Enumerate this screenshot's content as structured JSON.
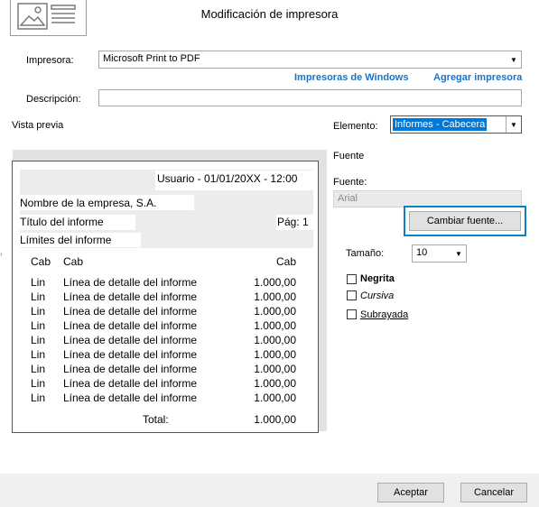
{
  "dialog": {
    "title": "Modificación de impresora"
  },
  "printer": {
    "label": "Impresora:",
    "value": "Microsoft Print to PDF",
    "windows_link": "Impresoras de Windows",
    "add_link": "Agregar impresora"
  },
  "description": {
    "label": "Descripción:",
    "value": ""
  },
  "preview": {
    "label": "Vista previa",
    "user_line": "Usuario - 01/01/20XX - 12:00",
    "company": "Nombre de la empresa, S.A.",
    "report_title": "Título del informe",
    "page": "Pág: 1",
    "limits": "Límites del informe",
    "columns": [
      "Cab",
      "Cab",
      "Cab"
    ],
    "rows": [
      {
        "c1": "Lin",
        "c2": "Línea de detalle del informe",
        "c3": "1.000,00"
      },
      {
        "c1": "Lin",
        "c2": "Línea de detalle del informe",
        "c3": "1.000,00"
      },
      {
        "c1": "Lin",
        "c2": "Línea de detalle del informe",
        "c3": "1.000,00"
      },
      {
        "c1": "Lin",
        "c2": "Línea de detalle del informe",
        "c3": "1.000,00"
      },
      {
        "c1": "Lin",
        "c2": "Línea de detalle del informe",
        "c3": "1.000,00"
      },
      {
        "c1": "Lin",
        "c2": "Línea de detalle del informe",
        "c3": "1.000,00"
      },
      {
        "c1": "Lin",
        "c2": "Línea de detalle del informe",
        "c3": "1.000,00"
      },
      {
        "c1": "Lin",
        "c2": "Línea de detalle del informe",
        "c3": "1.000,00"
      },
      {
        "c1": "Lin",
        "c2": "Línea de detalle del informe",
        "c3": "1.000,00"
      }
    ],
    "total_label": "Total:",
    "total_value": "1.000,00"
  },
  "element": {
    "label": "Elemento:",
    "value": "Informes - Cabecera"
  },
  "font_section": {
    "heading": "Fuente",
    "font_label": "Fuente:",
    "font_value": "Arial",
    "change_button": "Cambiar fuente...",
    "size_label": "Tamaño:",
    "size_value": "10",
    "bold": "Negrita",
    "italic": "Cursiva",
    "underline": "Subrayada"
  },
  "footer": {
    "accept": "Aceptar",
    "cancel": "Cancelar"
  },
  "colors": {
    "accent": "#1a73c6",
    "selection": "#0078d7",
    "focus": "#0e7fc1"
  },
  "icons": {
    "header": "printer-page-icon",
    "dropdown": "chevron-down-icon"
  }
}
